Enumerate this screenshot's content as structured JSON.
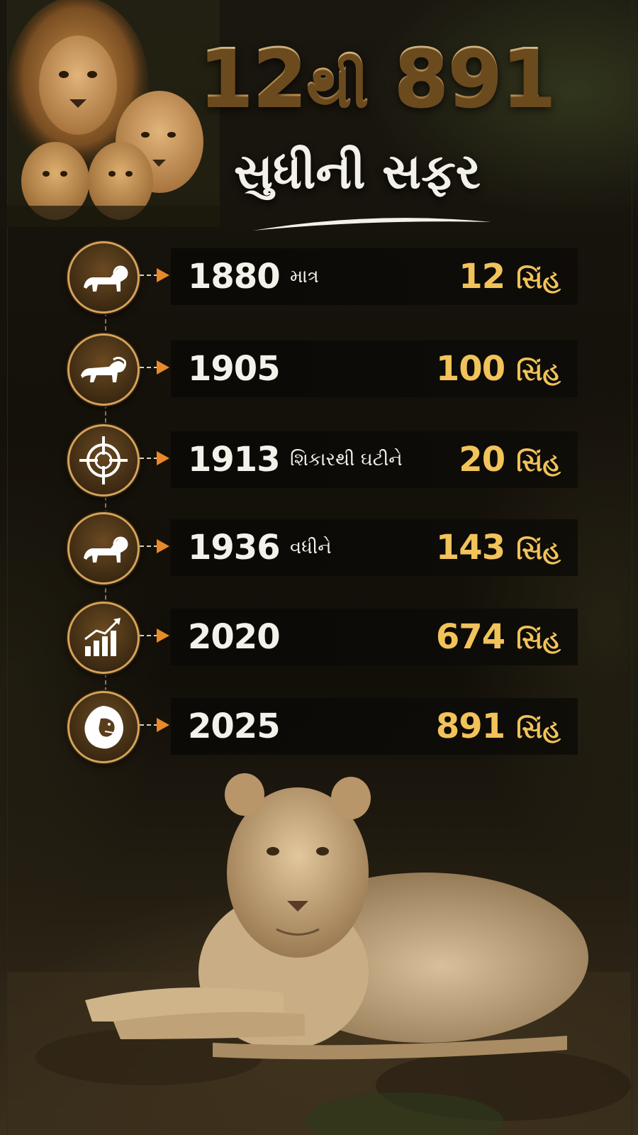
{
  "title": {
    "number_start": "12",
    "connector": "થી",
    "number_end": "891",
    "subtitle": "સુધીની સફર"
  },
  "colors": {
    "gold": "#f1c35a",
    "arrow": "#e8892a",
    "ring": "#d4a25a",
    "bar": "#0e0c08"
  },
  "timeline": [
    {
      "icon": "lion-standing-icon",
      "year": "1880",
      "note": "માત્ર",
      "count": "12",
      "unit": "સિંહ"
    },
    {
      "icon": "lion-walking-icon",
      "year": "1905",
      "note": "",
      "count": "100",
      "unit": "સિંહ"
    },
    {
      "icon": "crosshair-icon",
      "year": "1913",
      "note": "શિકારથી ઘટીને",
      "count": "20",
      "unit": "સિંહ"
    },
    {
      "icon": "lion-standing-icon",
      "year": "1936",
      "note": "વધીને",
      "count": "143",
      "unit": "સિંહ"
    },
    {
      "icon": "growth-chart-icon",
      "year": "2020",
      "note": "",
      "count": "674",
      "unit": "સિંહ"
    },
    {
      "icon": "lion-head-icon",
      "year": "2025",
      "note": "",
      "count": "891",
      "unit": "સિંહ"
    }
  ]
}
